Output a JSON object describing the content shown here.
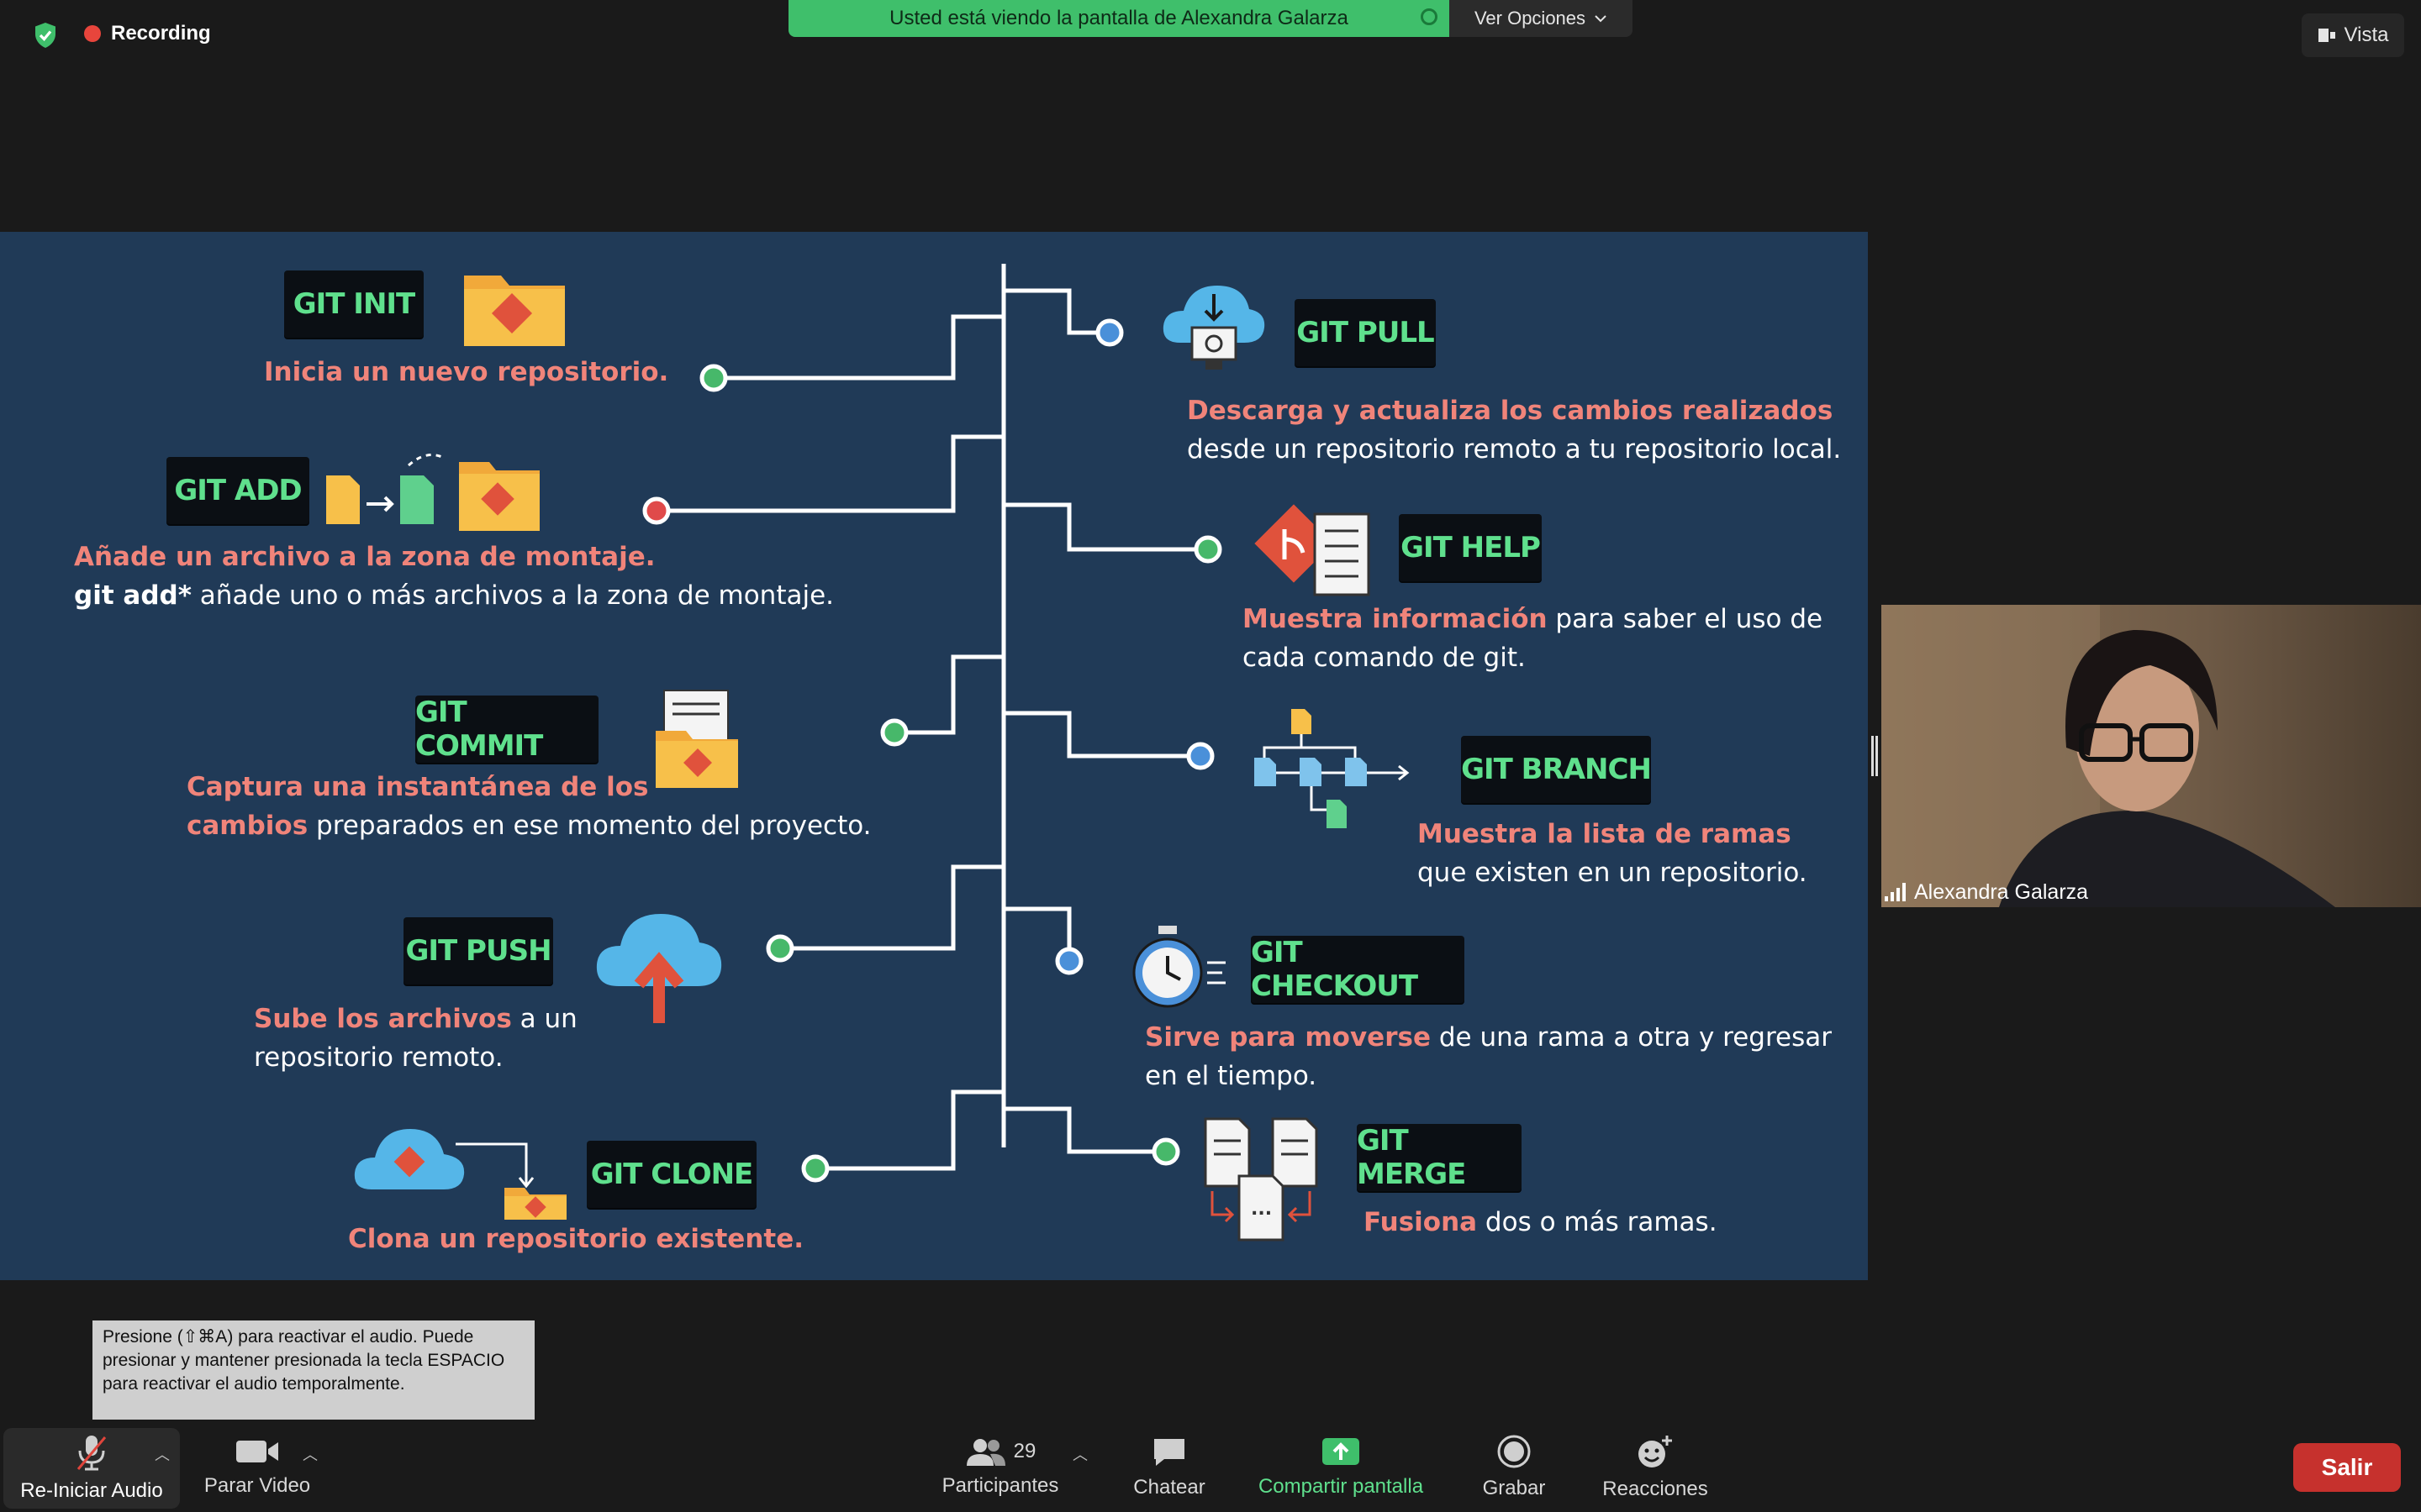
{
  "topbar": {
    "recording_label": "Recording",
    "share_banner": "Usted está viendo la pantalla de Alexandra Galarza",
    "view_options": "Ver Opciones",
    "view_button": "Vista"
  },
  "slide": {
    "left": [
      {
        "cmd": "GIT INIT",
        "text": [
          {
            "t": "Inicia un nuevo repositorio.",
            "hl": true
          }
        ]
      },
      {
        "cmd": "GIT ADD",
        "line1": [
          {
            "t": "Añade un archivo a la zona de montaje.",
            "hl": true
          }
        ],
        "line2_bold": "git add*",
        "line2": " añade uno o más archivos a la zona de montaje."
      },
      {
        "cmd": "GIT COMMIT",
        "line1": "Captura una instantánea de los",
        "line2_hl": "cambios",
        "line2": " preparados en ese momento del proyecto."
      },
      {
        "cmd": "GIT PUSH",
        "line1_hl": "Sube los archivos",
        "line1": " a un",
        "line2": "repositorio remoto."
      },
      {
        "cmd": "GIT CLONE",
        "line1": "Clona un repositorio existente."
      }
    ],
    "right": [
      {
        "cmd": "GIT PULL",
        "line1": "Descarga y actualiza los cambios realizados",
        "line2": "desde un repositorio remoto a tu repositorio local."
      },
      {
        "cmd": "GIT HELP",
        "line1_hl": "Muestra información",
        "line1": " para saber el uso de",
        "line2": "cada comando de git."
      },
      {
        "cmd": "GIT BRANCH",
        "line1": "Muestra la lista de ramas",
        "line2": "que existen en un repositorio."
      },
      {
        "cmd": "GIT CHECKOUT",
        "line1_hl": "Sirve para moverse",
        "line1": " de una rama a otra y regresar",
        "line2": "en el tiempo."
      },
      {
        "cmd": "GIT MERGE",
        "line1_hl": "Fusiona",
        "line1": " dos o más ramas."
      }
    ]
  },
  "participant": {
    "name": "Alexandra Galarza"
  },
  "tooltip": "Presione  (⇧⌘A) para reactivar el audio. Puede presionar y mantener presionada la tecla ESPACIO para reactivar el audio temporalmente.",
  "toolbar": {
    "audio": "Re-Iniciar Audio",
    "video": "Parar Video",
    "participants": "Participantes",
    "participants_count": "29",
    "chat": "Chatear",
    "share": "Compartir pantalla",
    "record": "Grabar",
    "reactions": "Reacciones",
    "leave": "Salir"
  },
  "colors": {
    "badge_text": "#5fe08d",
    "highlight": "#f0847a",
    "share_green": "#3fbf6b",
    "leave_red": "#c6312d",
    "slide_bg": "#203a57"
  }
}
